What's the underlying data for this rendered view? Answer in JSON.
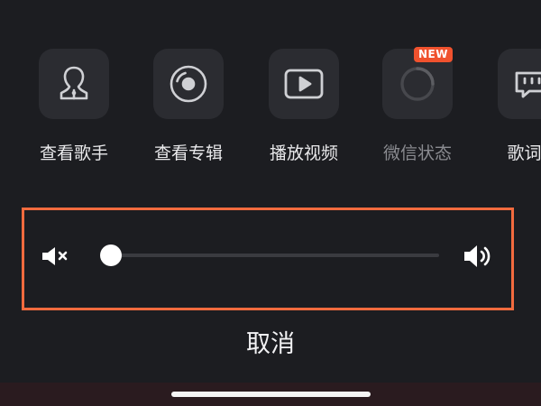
{
  "actions": [
    {
      "id": "singer",
      "label": "查看歌手",
      "icon": "singer-icon",
      "enabled": true
    },
    {
      "id": "album",
      "label": "查看专辑",
      "icon": "album-disc-icon",
      "enabled": true
    },
    {
      "id": "video",
      "label": "播放视频",
      "icon": "play-video-icon",
      "enabled": true
    },
    {
      "id": "wechat-status",
      "label": "微信状态",
      "icon": "status-ring-icon",
      "enabled": false,
      "badge": "NEW"
    },
    {
      "id": "lyrics",
      "label": "歌词海",
      "icon": "lyrics-quote-icon",
      "enabled": true
    }
  ],
  "volume": {
    "level": 0.0,
    "min_icon": "volume-mute-icon",
    "max_icon": "volume-max-icon"
  },
  "cancel_label": "取消",
  "colors": {
    "background": "#1c1d21",
    "tile": "#2b2c31",
    "highlight_border": "#f26b3e",
    "badge": "#f0522e",
    "text": "#e9e9eb",
    "disabled_text": "#8a8b90"
  }
}
